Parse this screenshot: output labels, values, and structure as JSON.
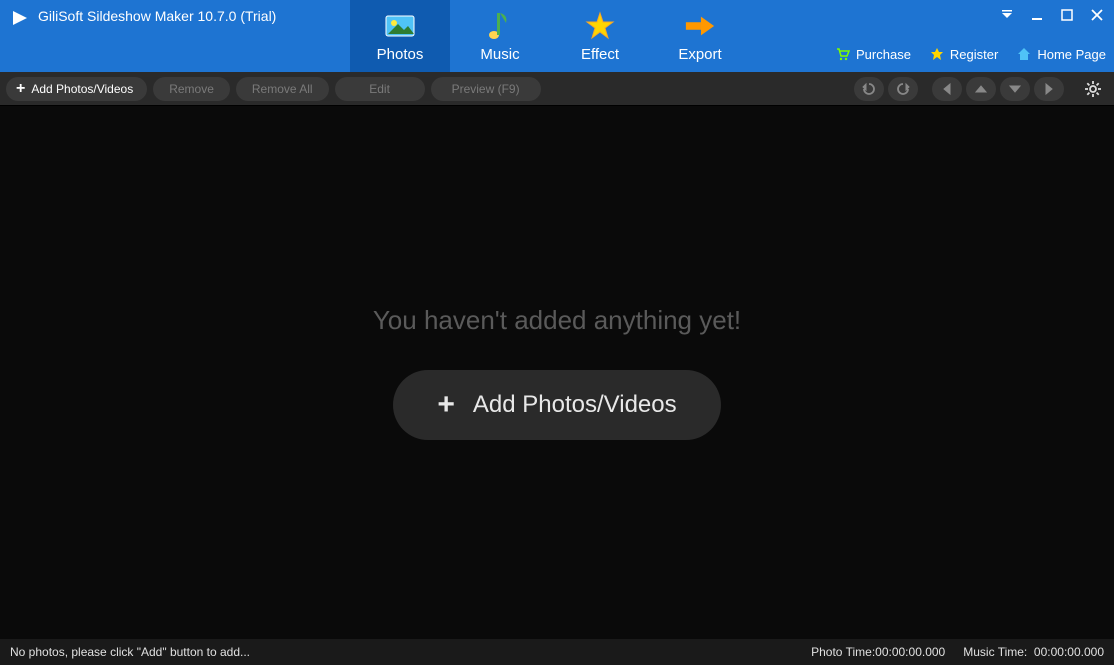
{
  "app": {
    "title": "GiliSoft Sildeshow Maker 10.7.0 (Trial)"
  },
  "tabs": {
    "photos": "Photos",
    "music": "Music",
    "effect": "Effect",
    "export": "Export"
  },
  "links": {
    "purchase": "Purchase",
    "register": "Register",
    "home": "Home Page"
  },
  "toolbar": {
    "add": "Add Photos/Videos",
    "remove": "Remove",
    "remove_all": "Remove All",
    "edit": "Edit",
    "preview": "Preview (F9)"
  },
  "main": {
    "empty": "You haven't added anything yet!",
    "add_big": "Add Photos/Videos"
  },
  "status": {
    "hint": "No photos, please click \"Add\" button to add...",
    "photo_time_label": "Photo Time:",
    "photo_time_value": "00:00:00.000",
    "music_time_label": "Music Time:",
    "music_time_value": "00:00:00.000"
  }
}
